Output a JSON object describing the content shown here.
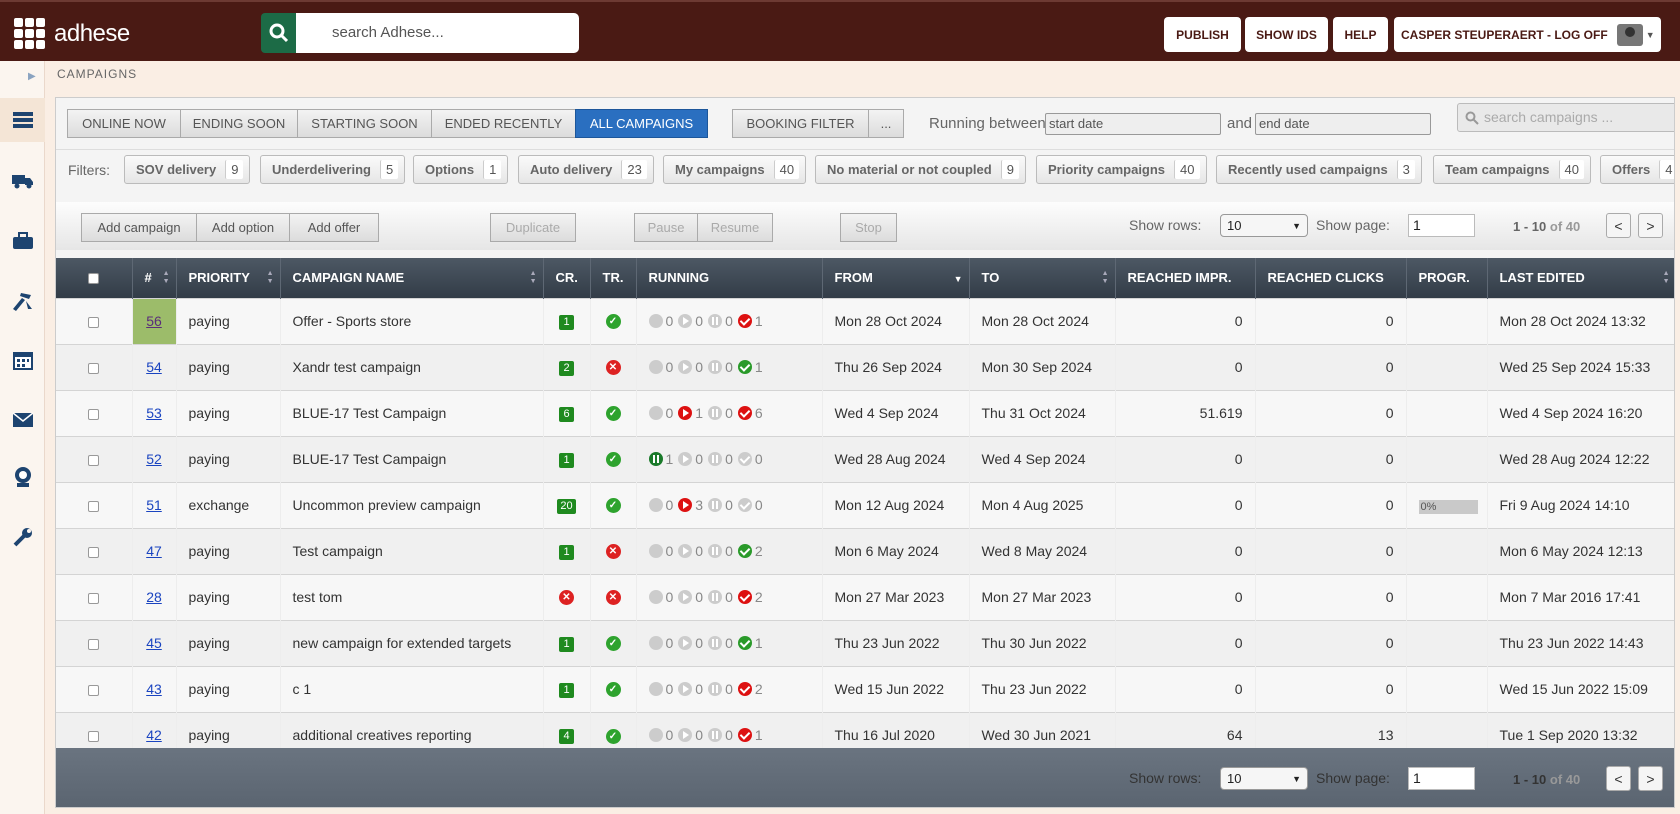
{
  "app": {
    "logo_text": "adhese"
  },
  "search": {
    "placeholder": "search Adhese..."
  },
  "topbar": {
    "publish": "PUBLISH",
    "show_ids": "SHOW IDS",
    "help": "HELP",
    "user": "CASPER STEUPERAERT - LOG OFF"
  },
  "sidebar": {
    "items": [
      "list-icon",
      "truck-icon",
      "briefcase-icon",
      "tools-icon",
      "calendar-icon",
      "mail-icon",
      "badge-icon",
      "wrench-icon"
    ]
  },
  "breadcrumb": "CAMPAIGNS",
  "tabs": [
    "ONLINE NOW",
    "ENDING SOON",
    "STARTING SOON",
    "ENDED RECENTLY",
    "ALL CAMPAIGNS"
  ],
  "booking": {
    "label": "BOOKING FILTER",
    "more": "..."
  },
  "range": {
    "label": "Running between",
    "and": "and",
    "start_placeholder": "start date",
    "end_placeholder": "end date"
  },
  "campaign_search": {
    "placeholder": "search campaigns ..."
  },
  "filters": {
    "label": "Filters:",
    "items": [
      {
        "label": "SOV delivery",
        "count": "9"
      },
      {
        "label": "Underdelivering",
        "count": "5"
      },
      {
        "label": "Options",
        "count": "1"
      },
      {
        "label": "Auto delivery",
        "count": "23"
      },
      {
        "label": "My campaigns",
        "count": "40"
      },
      {
        "label": "No material or not coupled",
        "count": "9"
      },
      {
        "label": "Priority campaigns",
        "count": "40"
      },
      {
        "label": "Recently used campaigns",
        "count": "3"
      },
      {
        "label": "Team campaigns",
        "count": "40"
      },
      {
        "label": "Offers",
        "count": "4"
      }
    ]
  },
  "actions": {
    "add_campaign": "Add campaign",
    "add_option": "Add option",
    "add_offer": "Add offer",
    "duplicate": "Duplicate",
    "pause": "Pause",
    "resume": "Resume",
    "stop": "Stop"
  },
  "pagination": {
    "show_rows_label": "Show rows:",
    "rows": "10",
    "show_page_label": "Show page:",
    "page": "1",
    "range": "1 - 10",
    "of": "of 40",
    "prev": "<",
    "next": ">"
  },
  "columns": [
    "#",
    "PRIORITY",
    "CAMPAIGN NAME",
    "CR.",
    "TR.",
    "RUNNING",
    "FROM",
    "TO",
    "REACHED IMPR.",
    "REACHED CLICKS",
    "PROGR.",
    "LAST EDITED"
  ],
  "rows": [
    {
      "id": "56",
      "priority": "paying",
      "name": "Offer - Sports store",
      "cr": "1",
      "tr": "ok",
      "run": [
        [
          "c",
          "0"
        ],
        [
          "play",
          "0"
        ],
        [
          "pause",
          "0"
        ],
        [
          "check-red",
          "1"
        ]
      ],
      "from": "Mon 28 Oct 2024",
      "to": "Mon 28 Oct 2024",
      "impr": "0",
      "clicks": "0",
      "progr": "",
      "edited": "Mon 28 Oct 2024 13:32",
      "hl": true
    },
    {
      "id": "54",
      "priority": "paying",
      "name": "Xandr test campaign",
      "cr": "2",
      "tr": "no",
      "run": [
        [
          "c",
          "0"
        ],
        [
          "play",
          "0"
        ],
        [
          "pause",
          "0"
        ],
        [
          "check-green",
          "1"
        ]
      ],
      "from": "Thu 26 Sep 2024",
      "to": "Mon 30 Sep 2024",
      "impr": "0",
      "clicks": "0",
      "progr": "",
      "edited": "Wed 25 Sep 2024 15:33"
    },
    {
      "id": "53",
      "priority": "paying",
      "name": "BLUE-17 Test Campaign",
      "cr": "6",
      "tr": "ok",
      "run": [
        [
          "c",
          "0"
        ],
        [
          "play-red",
          "1"
        ],
        [
          "pause",
          "0"
        ],
        [
          "check-red",
          "6"
        ]
      ],
      "from": "Wed 4 Sep 2024",
      "to": "Thu 31 Oct 2024",
      "impr": "51.619",
      "clicks": "0",
      "progr": "",
      "edited": "Wed 4 Sep 2024 16:20"
    },
    {
      "id": "52",
      "priority": "paying",
      "name": "BLUE-17 Test Campaign",
      "cr": "1",
      "tr": "ok",
      "run": [
        [
          "pause-green",
          "1"
        ],
        [
          "play",
          "0"
        ],
        [
          "pause",
          "0"
        ],
        [
          "check",
          "0"
        ]
      ],
      "from": "Wed 28 Aug 2024",
      "to": "Wed 4 Sep 2024",
      "impr": "0",
      "clicks": "0",
      "progr": "",
      "edited": "Wed 28 Aug 2024 12:22"
    },
    {
      "id": "51",
      "priority": "exchange",
      "name": "Uncommon preview campaign",
      "cr": "20",
      "tr": "ok",
      "run": [
        [
          "c",
          "0"
        ],
        [
          "play-red",
          "3"
        ],
        [
          "pause",
          "0"
        ],
        [
          "check",
          "0"
        ]
      ],
      "from": "Mon 12 Aug 2024",
      "to": "Mon 4 Aug 2025",
      "impr": "0",
      "clicks": "0",
      "progr": "0%",
      "edited": "Fri 9 Aug 2024 14:10"
    },
    {
      "id": "47",
      "priority": "paying",
      "name": "Test campaign",
      "cr": "1",
      "tr": "no",
      "run": [
        [
          "c",
          "0"
        ],
        [
          "play",
          "0"
        ],
        [
          "pause",
          "0"
        ],
        [
          "check-green",
          "2"
        ]
      ],
      "from": "Mon 6 May 2024",
      "to": "Wed 8 May 2024",
      "impr": "0",
      "clicks": "0",
      "progr": "",
      "edited": "Mon 6 May 2024 12:13"
    },
    {
      "id": "28",
      "priority": "paying",
      "name": "test tom",
      "cr": "x",
      "tr": "no",
      "run": [
        [
          "c",
          "0"
        ],
        [
          "play",
          "0"
        ],
        [
          "pause",
          "0"
        ],
        [
          "check-red",
          "2"
        ]
      ],
      "from": "Mon 27 Mar 2023",
      "to": "Mon 27 Mar 2023",
      "impr": "0",
      "clicks": "0",
      "progr": "",
      "edited": "Mon 7 Mar 2016 17:41"
    },
    {
      "id": "45",
      "priority": "paying",
      "name": "new campaign for extended targets",
      "cr": "1",
      "tr": "ok",
      "run": [
        [
          "c",
          "0"
        ],
        [
          "play",
          "0"
        ],
        [
          "pause",
          "0"
        ],
        [
          "check-green",
          "1"
        ]
      ],
      "from": "Thu 23 Jun 2022",
      "to": "Thu 30 Jun 2022",
      "impr": "0",
      "clicks": "0",
      "progr": "",
      "edited": "Thu 23 Jun 2022 14:43"
    },
    {
      "id": "43",
      "priority": "paying",
      "name": "c 1",
      "cr": "1",
      "tr": "ok",
      "run": [
        [
          "c",
          "0"
        ],
        [
          "play",
          "0"
        ],
        [
          "pause",
          "0"
        ],
        [
          "check-red",
          "2"
        ]
      ],
      "from": "Wed 15 Jun 2022",
      "to": "Thu 23 Jun 2022",
      "impr": "0",
      "clicks": "0",
      "progr": "",
      "edited": "Wed 15 Jun 2022 15:09"
    },
    {
      "id": "42",
      "priority": "paying",
      "name": "additional creatives reporting",
      "cr": "4",
      "tr": "ok",
      "run": [
        [
          "c",
          "0"
        ],
        [
          "play",
          "0"
        ],
        [
          "pause",
          "0"
        ],
        [
          "check-red",
          "1"
        ]
      ],
      "from": "Thu 16 Jul 2020",
      "to": "Wed 30 Jun 2021",
      "impr": "64",
      "clicks": "13",
      "progr": "",
      "edited": "Tue 1 Sep 2020 13:32"
    }
  ]
}
